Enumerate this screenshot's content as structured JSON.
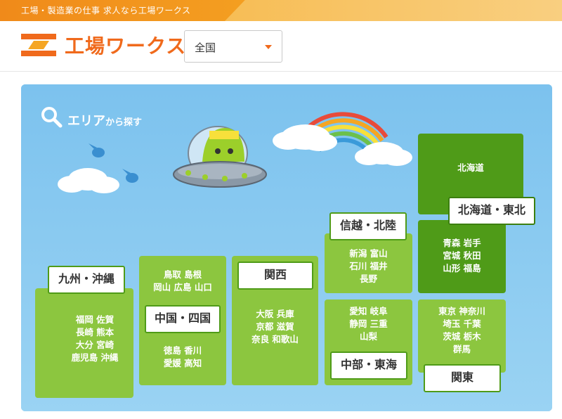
{
  "topbar": {
    "tagline": "工場・製造業の仕事 求人なら工場ワークス"
  },
  "header": {
    "logo_text": "工場ワークス",
    "region_select": {
      "value": "全国"
    }
  },
  "area_search": {
    "heading_main": "エリア",
    "heading_sub": "から探す"
  },
  "regions": {
    "hokkaido": {
      "pref_list": "北海道"
    },
    "tohoku": {
      "label": "北海道・東北",
      "prefs": [
        "青森 岩手",
        "宮城 秋田",
        "山形 福島"
      ]
    },
    "shinetsu": {
      "label": "信越・北陸",
      "prefs": [
        "新潟 富山",
        "石川 福井",
        "長野"
      ]
    },
    "chubu": {
      "label": "中部・東海",
      "prefs": [
        "愛知 岐阜",
        "静岡 三重",
        "山梨"
      ]
    },
    "kanto": {
      "label": "関東",
      "prefs": [
        "東京 神奈川",
        "埼玉 千葉",
        "茨城 栃木",
        "群馬"
      ]
    },
    "kansai": {
      "label": "関西",
      "prefs": [
        "大阪 兵庫",
        "京都 滋賀",
        "奈良 和歌山"
      ]
    },
    "chugoku": {
      "label": "中国・四国",
      "prefs_top": [
        "鳥取 島根",
        "岡山 広島 山口"
      ],
      "prefs_bottom": [
        "徳島 香川",
        "愛媛 高知"
      ]
    },
    "kyushu": {
      "label": "九州・沖縄",
      "prefs": [
        "福岡 佐賀",
        "長崎 熊本",
        "大分 宮崎",
        "鹿児島 沖縄"
      ]
    }
  },
  "colors": {
    "brand_orange": "#f06a1c",
    "sky_blue": "#87c8ef",
    "region_green": "#8cc63f",
    "region_dark_green": "#4f9b18"
  }
}
